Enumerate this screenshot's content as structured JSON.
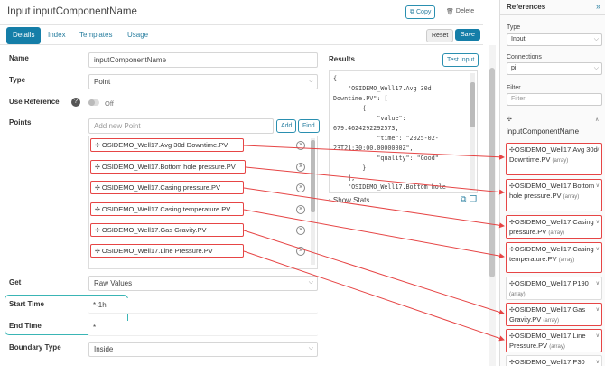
{
  "header": {
    "title": "Input inputComponentName",
    "copy_label": "Copy",
    "delete_label": "Delete"
  },
  "tabs": [
    {
      "label": "Details"
    },
    {
      "label": "Index"
    },
    {
      "label": "Templates"
    },
    {
      "label": "Usage"
    }
  ],
  "actions": {
    "reset_label": "Reset",
    "save_label": "Save"
  },
  "form": {
    "name_label": "Name",
    "name_value": "inputComponentName",
    "type_label": "Type",
    "type_value": "Point",
    "use_reference_label": "Use Reference",
    "use_reference_value": "Off",
    "points_label": "Points",
    "add_point_placeholder": "Add new Point",
    "add_label": "Add",
    "find_label": "Find",
    "points": [
      "OSIDEMO_Well17.Avg 30d Downtime.PV",
      "OSIDEMO_Well17.Bottom hole pressure.PV",
      "OSIDEMO_Well17.Casing pressure.PV",
      "OSIDEMO_Well17.Casing temperature.PV",
      "OSIDEMO_Well17.Gas Gravity.PV",
      "OSIDEMO_Well17.Line Pressure.PV"
    ],
    "get_label": "Get",
    "get_value": "Raw Values",
    "start_time_label": "Start Time",
    "start_time_value": "*-1h",
    "end_time_label": "End Time",
    "end_time_value": "*",
    "boundary_type_label": "Boundary Type",
    "boundary_type_value": "Inside"
  },
  "results": {
    "label": "Results",
    "test_input_label": "Test Input",
    "lines": [
      "{",
      "    \"OSIDEMO_Well17.Avg 30d",
      "Downtime.PV\": [",
      "        {",
      "            \"value\":",
      "679.4624292292573,",
      "            \"time\": \"2025-02-",
      "23T21:30:00.0000000Z\",",
      "            \"quality\": \"Good\"",
      "        }",
      "    ],",
      "    \"OSIDEMO_Well17.Bottom hole"
    ],
    "show_stats_label": "Show Stats"
  },
  "references_panel": {
    "title": "References",
    "type_label": "Type",
    "type_value": "Input",
    "connections_label": "Connections",
    "connections_value": "pi",
    "filter_label": "Filter",
    "filter_placeholder": "Filter",
    "component_name": "inputComponentName",
    "array_tag": "(array)",
    "items": [
      {
        "text": "OSIDEMO_Well17.Avg 30d Downtime.PV"
      },
      {
        "text": "OSIDEMO_Well17.Bottom hole pressure.PV"
      },
      {
        "text": "OSIDEMO_Well17.Casing pressure.PV"
      },
      {
        "text": "OSIDEMO_Well17.Casing temperature.PV"
      },
      {
        "text": "OSIDEMO_Well17.Gas Gravity.PV"
      },
      {
        "text": "OSIDEMO_Well17.Line Pressure.PV"
      },
      {
        "text": "OSIDEMO_Well17.P190"
      },
      {
        "text": "OSIDEMO_Well17.P30"
      }
    ]
  },
  "colors": {
    "accent": "#157ea8",
    "highlight_red": "#e64545",
    "highlight_teal": "#3ab5b5"
  }
}
